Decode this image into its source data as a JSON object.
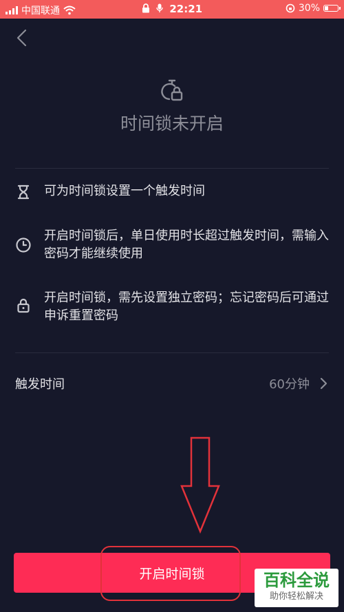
{
  "status_bar": {
    "carrier": "中国联通",
    "time": "22:21",
    "battery": "30%"
  },
  "header": {
    "title": "时间锁未开启"
  },
  "features": [
    {
      "icon": "hourglass-icon",
      "text": "可为时间锁设置一个触发时间"
    },
    {
      "icon": "clock-icon",
      "text": "开启时间锁后，单日使用时长超过触发时间，需输入密码才能继续使用"
    },
    {
      "icon": "lock-icon",
      "text": "开启时间锁，需先设置独立密码；忘记密码后可通过申诉重置密码"
    }
  ],
  "setting": {
    "label": "触发时间",
    "value": "60分钟"
  },
  "button": {
    "label": "开启时间锁"
  },
  "watermark": {
    "main": "百科全说",
    "sub": "助你轻松解决"
  },
  "colors": {
    "status_bar": "#f35b5b",
    "background": "#16182a",
    "primary": "#fe2c55",
    "annotation": "#e2323a"
  }
}
